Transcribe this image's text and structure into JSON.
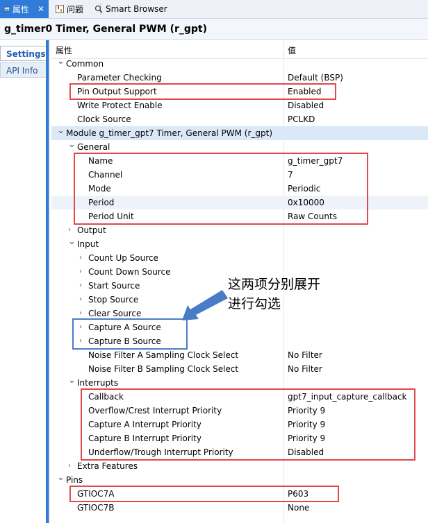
{
  "tabs": [
    {
      "label": "属性",
      "icon": "properties-icon",
      "active": true
    },
    {
      "label": "问题",
      "icon": "problems-icon",
      "active": false
    },
    {
      "label": "Smart Browser",
      "icon": "smart-browser-icon",
      "active": false
    }
  ],
  "title": "g_timer0 Timer, General PWM (r_gpt)",
  "side_tabs": {
    "settings": "Settings",
    "api_info": "API Info"
  },
  "header": {
    "property": "属性",
    "value": "值"
  },
  "rows": [
    {
      "label": "Common",
      "value": "",
      "chev": "v"
    },
    {
      "label": "Parameter Checking",
      "value": "Default (BSP)",
      "chev": ""
    },
    {
      "label": "Pin Output Support",
      "value": "Enabled",
      "chev": ""
    },
    {
      "label": "Write Protect Enable",
      "value": "Disabled",
      "chev": ""
    },
    {
      "label": "Clock Source",
      "value": "PCLKD",
      "chev": ""
    },
    {
      "label": "Module g_timer_gpt7 Timer, General PWM (r_gpt)",
      "value": "",
      "chev": "v"
    },
    {
      "label": "General",
      "value": "",
      "chev": "v"
    },
    {
      "label": "Name",
      "value": "g_timer_gpt7",
      "chev": ""
    },
    {
      "label": "Channel",
      "value": "7",
      "chev": ""
    },
    {
      "label": "Mode",
      "value": "Periodic",
      "chev": ""
    },
    {
      "label": "Period",
      "value": "0x10000",
      "chev": ""
    },
    {
      "label": "Period Unit",
      "value": "Raw Counts",
      "chev": ""
    },
    {
      "label": "Output",
      "value": "",
      "chev": ">"
    },
    {
      "label": "Input",
      "value": "",
      "chev": "v"
    },
    {
      "label": "Count Up Source",
      "value": "",
      "chev": ">"
    },
    {
      "label": "Count Down Source",
      "value": "",
      "chev": ">"
    },
    {
      "label": "Start Source",
      "value": "",
      "chev": ">"
    },
    {
      "label": "Stop Source",
      "value": "",
      "chev": ">"
    },
    {
      "label": "Clear Source",
      "value": "",
      "chev": ">"
    },
    {
      "label": "Capture A Source",
      "value": "",
      "chev": ">"
    },
    {
      "label": "Capture B Source",
      "value": "",
      "chev": ">"
    },
    {
      "label": "Noise Filter A Sampling Clock Select",
      "value": "No Filter",
      "chev": ""
    },
    {
      "label": "Noise Filter B Sampling Clock Select",
      "value": "No Filter",
      "chev": ""
    },
    {
      "label": "Interrupts",
      "value": "",
      "chev": "v"
    },
    {
      "label": "Callback",
      "value": "gpt7_input_capture_callback",
      "chev": ""
    },
    {
      "label": "Overflow/Crest Interrupt Priority",
      "value": "Priority 9",
      "chev": ""
    },
    {
      "label": "Capture A Interrupt Priority",
      "value": "Priority 9",
      "chev": ""
    },
    {
      "label": "Capture B Interrupt Priority",
      "value": "Priority 9",
      "chev": ""
    },
    {
      "label": "Underflow/Trough Interrupt Priority",
      "value": "Disabled",
      "chev": ""
    },
    {
      "label": "Extra Features",
      "value": "",
      "chev": ">"
    },
    {
      "label": "Pins",
      "value": "",
      "chev": "v"
    },
    {
      "label": "GTIOC7A",
      "value": "P603",
      "chev": ""
    },
    {
      "label": "GTIOC7B",
      "value": "None",
      "chev": ""
    }
  ],
  "annotation": {
    "line1": "这两项分别展开",
    "line2": "进行勾选"
  },
  "colors": {
    "accent": "#2f7bd8",
    "highlight_red": "#e0484a",
    "highlight_blue": "#4a7cc5",
    "selected_row": "#dbe8f8"
  }
}
